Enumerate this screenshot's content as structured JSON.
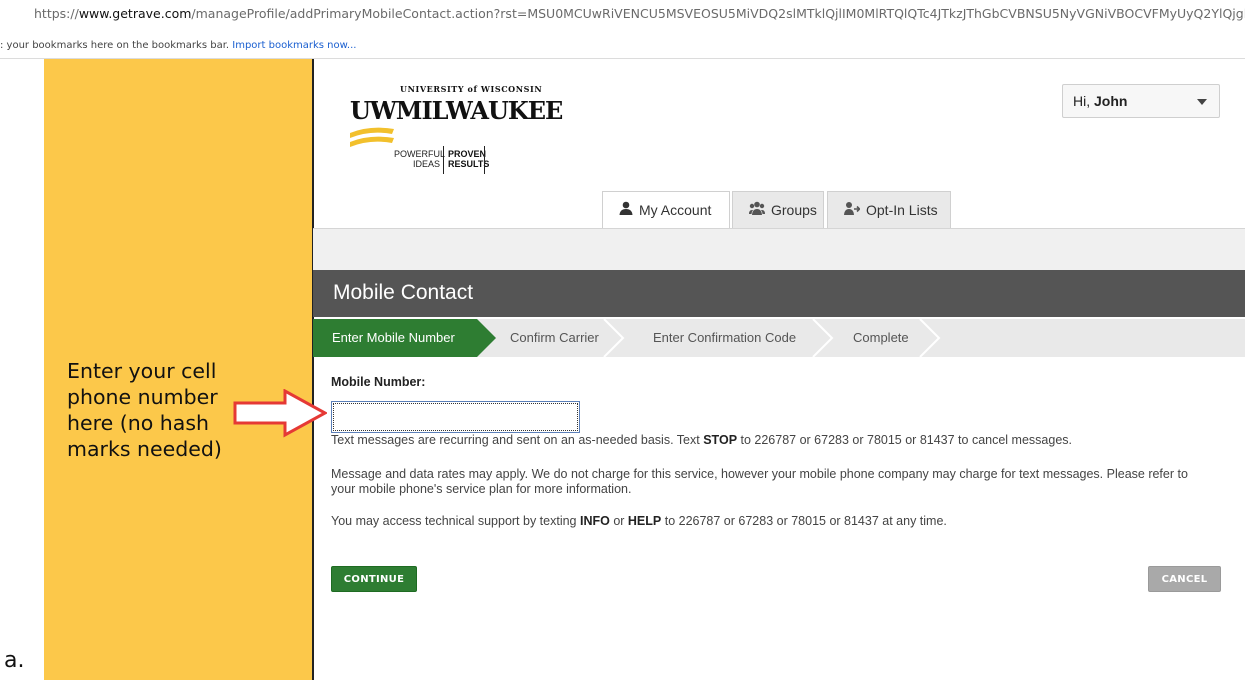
{
  "browser": {
    "url_scheme": "https://",
    "url_domain": "www.getrave.com",
    "url_path": "/manageProfile/addPrimaryMobileContact.action?rst=MSU0MCUwRiVENCU5MSVEOSU5MiVDQ2slMTklQjlIM0MlRTQlQTc4JTkzJThGbCVBNSU5NyVGNiVBOCVFMyUyQ2YlQjglF",
    "bookmarks_text": ": your bookmarks here on the bookmarks bar.",
    "bookmarks_link": "Import bookmarks now..."
  },
  "annotation": {
    "note": "Enter your cell phone number here (no hash marks needed)",
    "marker": "a.",
    "arrow_color": "#e53935",
    "panel_color": "#fcc84a"
  },
  "logo": {
    "line1": "UNIVERSITY of WISCONSIN",
    "line2": "UWMILWAUKEE",
    "tag_left": "POWERFUL IDEAS",
    "tag_right": "PROVEN RESULTS"
  },
  "user_menu": {
    "greeting": "Hi,",
    "name": "John"
  },
  "tabs": [
    {
      "label": "My Account",
      "icon": "user-icon",
      "active": true
    },
    {
      "label": "Groups",
      "icon": "users-icon",
      "active": false
    },
    {
      "label": "Opt-In Lists",
      "icon": "user-add-icon",
      "active": false
    }
  ],
  "page": {
    "title": "Mobile Contact"
  },
  "steps": [
    {
      "label": "Enter Mobile Number",
      "active": true
    },
    {
      "label": "Confirm Carrier",
      "active": false
    },
    {
      "label": "Enter Confirmation Code",
      "active": false
    },
    {
      "label": "Complete",
      "active": false
    }
  ],
  "form": {
    "label": "Mobile Number:",
    "value": "",
    "placeholder": ""
  },
  "info": {
    "p1_pre": "Text messages are recurring and sent on an as-needed basis. Text ",
    "p1_bold": "STOP",
    "p1_post": " to 226787 or 67283 or 78015 or 81437 to cancel messages.",
    "p2": "Message and data rates may apply. We do not charge for this service, however your mobile phone company may charge for text messages. Please refer to your mobile phone's service plan for more information.",
    "p3_pre": "You may access technical support by texting ",
    "p3_b1": "INFO",
    "p3_mid": " or ",
    "p3_b2": "HELP",
    "p3_post": " to 226787 or 67283 or 78015 or 81437 at any time."
  },
  "buttons": {
    "continue": "CONTINUE",
    "cancel": "CANCEL"
  },
  "colors": {
    "accent_green": "#2e7d32",
    "header_gray": "#555555"
  }
}
